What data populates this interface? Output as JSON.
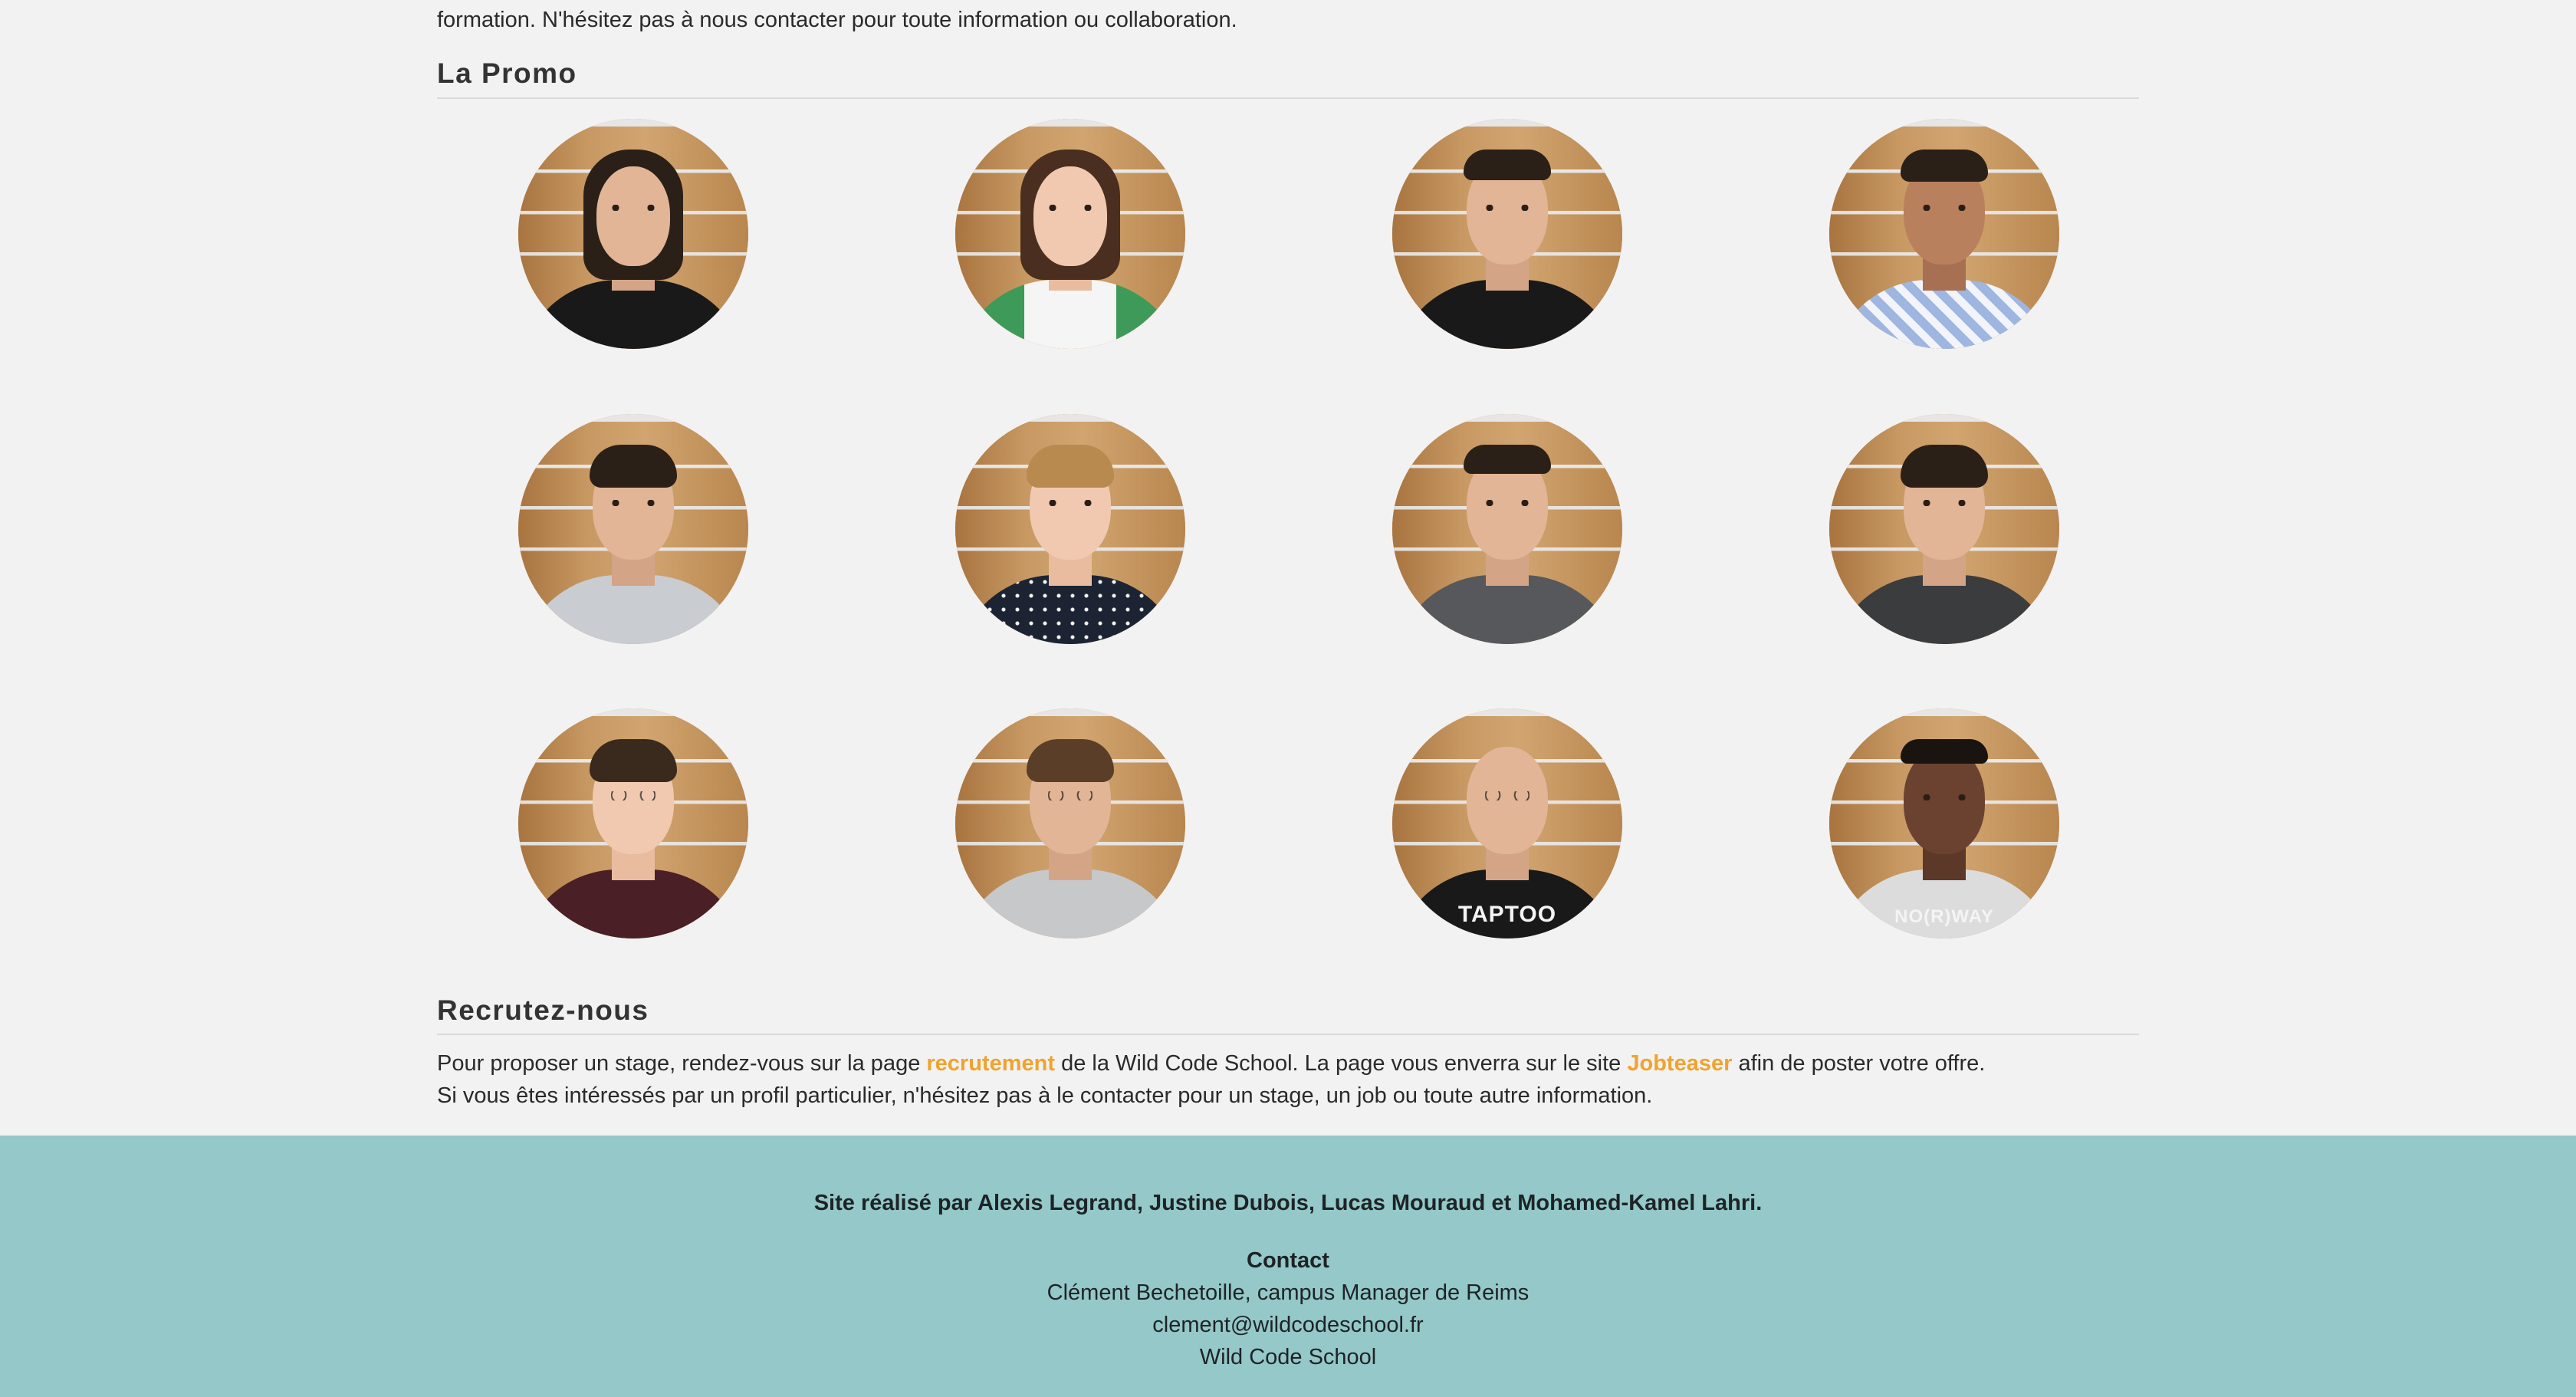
{
  "intro": {
    "text": "formation. N'hésitez pas à nous contacter pour toute information ou collaboration."
  },
  "promo": {
    "title": "La Promo"
  },
  "recruit": {
    "title": "Recrutez-nous",
    "line1_before": "Pour proposer un stage, rendez-vous sur la page ",
    "link_recrutement": "recrutement",
    "line1_middle": " de la Wild Code School. La page vous enverra sur le site ",
    "link_jobteaser": "Jobteaser",
    "line1_after": " afin de poster votre offre.",
    "line2": "Si vous êtes intéressés par un profil particulier, n'hésitez pas à le contacter pour un stage, un job ou toute autre information."
  },
  "footer": {
    "credits": "Site réalisé par Alexis Legrand, Justine Dubois, Lucas Mouraud et Mohamed-Kamel Lahri.",
    "contact_title": "Contact",
    "contact_name": "Clément Bechetoille, campus Manager de Reims",
    "contact_email": "clement@wildcodeschool.fr",
    "contact_org": "Wild Code School"
  },
  "photos": [
    {
      "shirt_text": ""
    },
    {
      "shirt_text": ""
    },
    {
      "shirt_text": ""
    },
    {
      "shirt_text": ""
    },
    {
      "shirt_text": ""
    },
    {
      "shirt_text": ""
    },
    {
      "shirt_text": ""
    },
    {
      "shirt_text": ""
    },
    {
      "shirt_text": ""
    },
    {
      "shirt_text": ""
    },
    {
      "shirt_text": "TAPTOO"
    },
    {
      "shirt_text": "NO(R)WAY"
    }
  ],
  "colors": {
    "page_bg": "#f2f2f2",
    "footer_bg": "#95c8c8",
    "link_accent": "#f0a32e"
  }
}
